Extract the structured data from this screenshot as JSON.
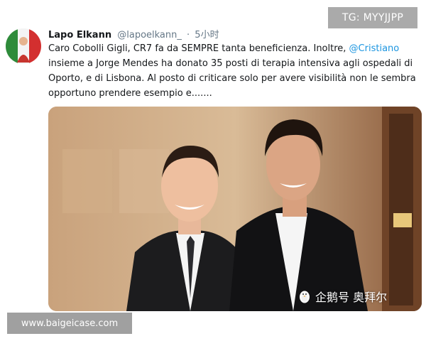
{
  "tweet": {
    "author_name": "Lapo Elkann",
    "author_handle": "@lapoelkann_",
    "separator": "·",
    "time": "5小时",
    "text_parts": [
      "Caro Cobolli Gigli, CR7 fa da SEMPRE tanta beneficienza. Inoltre, ",
      "@Cristiano",
      " insieme a Jorge Mendes ha donato 35 posti di terapia intensiva agli ospedali di Oporto, e di Lisbona. Al posto di criticare solo per avere visibilità non le sembra opportuno prendere esempio e......."
    ],
    "avatar_icon": "avatar-icon",
    "mention_color": "#1b95e0"
  },
  "watermarks": {
    "tg": "TG: MYYJJPP",
    "site": "www.baigeicase.com",
    "penguin_text": "企鹅号 奥拜尔",
    "penguin_icon": "penguin-icon"
  }
}
